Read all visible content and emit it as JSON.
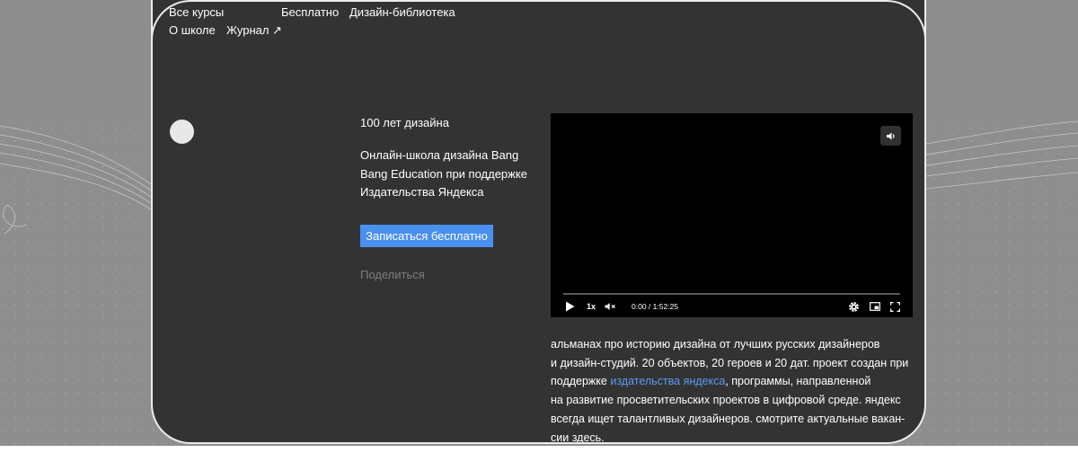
{
  "nav": {
    "all_courses": "Все курсы",
    "free": "Бесплатно",
    "design_library": "Дизайн-библиотека",
    "about": "О школе",
    "journal": "Журнал ↗"
  },
  "course": {
    "title": "100 лет дизайна",
    "description": "Онлайн-школа дизайна Bang Bang Education при поддержке Издательства Яндекса",
    "cta_label": "Записаться бесплатно",
    "share_label": "Поделиться"
  },
  "video": {
    "speed": "1x",
    "time": "0:00 / 1:52:25",
    "progress": 0,
    "icons": [
      "volume-icon",
      "play-icon",
      "mute-icon",
      "settings-icon",
      "miniplayer-icon",
      "fullscreen-icon"
    ]
  },
  "about": {
    "line1": "альманах про историю дизайна от лучших русских дизайнеров",
    "line2": "и дизайн-студий. 20 объектов, 20 героев и 20 дат. проект создан при",
    "line3_pre": "поддержке ",
    "line3_link": "издательства яндекса",
    "line3_post": ", программы, направленной",
    "line4": "на развитие просветительских проектов в цифровой среде. яндекс",
    "line5": "всегда ищет талантливых дизайнеров. смотрите актуальные вакан-",
    "line6": "сии здесь."
  },
  "colors": {
    "page_bg": "#8e8e8e",
    "card_bg": "#333333",
    "accent": "#4a90f0",
    "link": "#5b9cf2",
    "muted": "#7d7d7d"
  }
}
